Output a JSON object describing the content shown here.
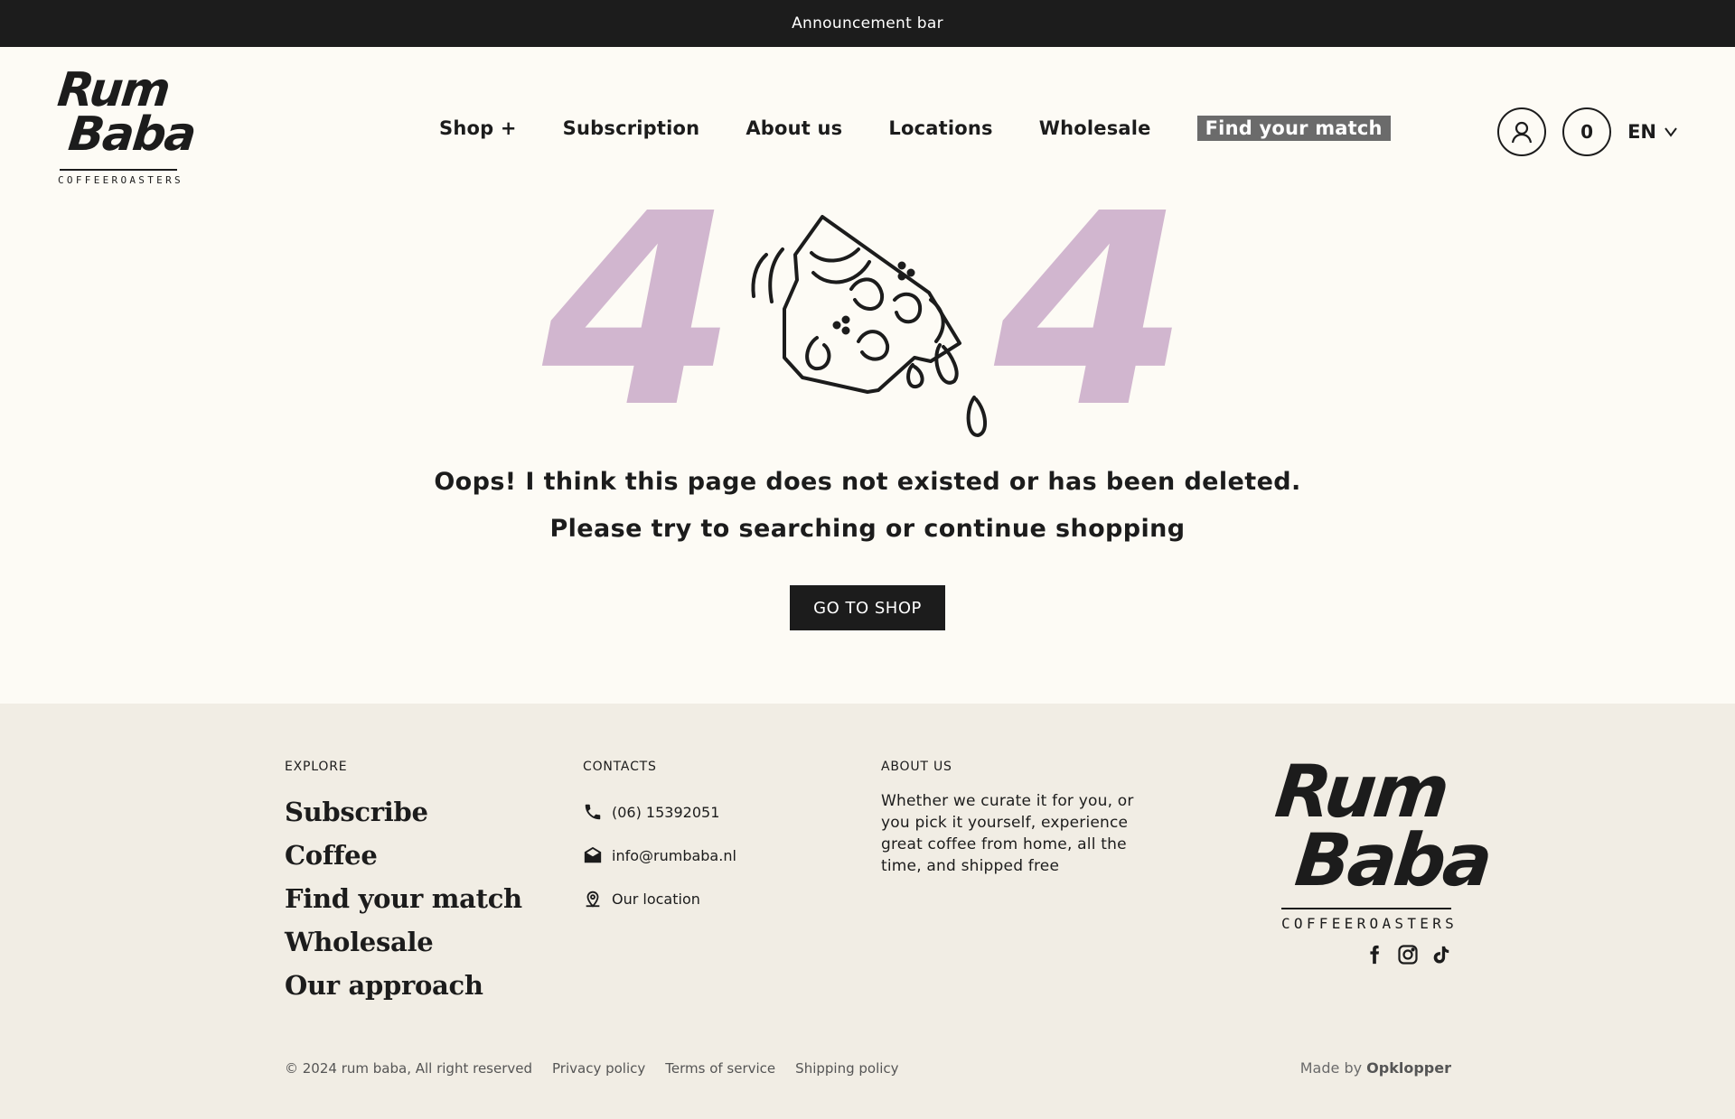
{
  "announcement": "Announcement bar",
  "brand": {
    "name_line1": "Rum",
    "name_line2": "Baba",
    "tagline": "COFFEEROASTERS"
  },
  "nav": {
    "items": [
      "Shop +",
      "Subscription",
      "About us",
      "Locations",
      "Wholesale"
    ],
    "highlight": "Find your match"
  },
  "header": {
    "cart_count": "0",
    "language": "EN",
    "icons": [
      "user-icon",
      "chevron-down-icon"
    ]
  },
  "hero": {
    "digit_left": "4",
    "digit_right": "4",
    "digit_color": "#d1b6cf"
  },
  "message": {
    "line1": "Oops! I think this page does not existed or has been deleted.",
    "line2": "Please try to searching or continue shopping",
    "cta": "GO TO SHOP"
  },
  "footer": {
    "explore": {
      "heading": "EXPLORE",
      "links": [
        "Subscribe",
        "Coffee",
        "Find your match",
        "Wholesale",
        "Our approach"
      ]
    },
    "contacts": {
      "heading": "CONTACTS",
      "phone": "(06) 15392051",
      "email": "info@rumbaba.nl",
      "location": "Our location",
      "icons": [
        "phone-icon",
        "mail-icon",
        "location-pin-icon"
      ]
    },
    "about": {
      "heading": "ABOUT US",
      "text": "Whether we curate it for you, or you pick it yourself, experience great coffee from home, all the time, and shipped free"
    },
    "social_icons": [
      "facebook-icon",
      "instagram-icon",
      "tiktok-icon"
    ],
    "copyright": "© 2024 rum baba, All right reserved",
    "legal_links": [
      "Privacy policy",
      "Terms of service",
      "Shipping policy"
    ],
    "made_by_prefix": "Made by",
    "made_by_name": "Opklopper"
  },
  "colors": {
    "dark": "#1c1c1c",
    "page_bg": "#fdfbf5",
    "footer_bg": "#f1ede4",
    "highlight_bg": "#6b6b6b"
  }
}
